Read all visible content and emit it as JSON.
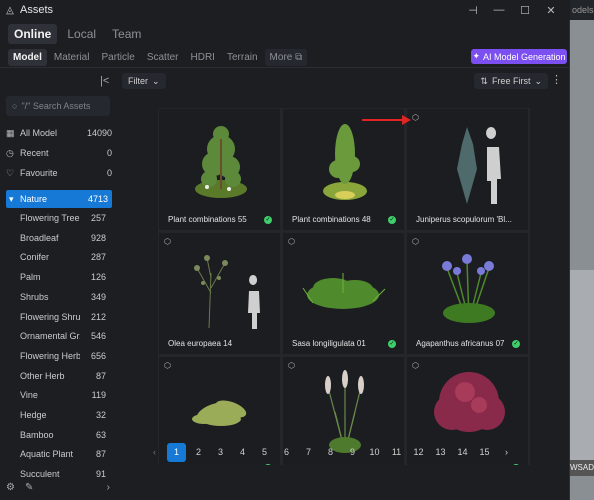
{
  "window": {
    "title": "Assets",
    "controls": [
      "⊣",
      "—",
      "☐",
      "✕"
    ]
  },
  "background_app": {
    "strip_text": "odels 0",
    "wsad_text": "WSAD"
  },
  "source_tabs": [
    {
      "label": "Online",
      "active": true
    },
    {
      "label": "Local",
      "active": false
    },
    {
      "label": "Team",
      "active": false
    }
  ],
  "type_tabs": [
    {
      "label": "Model",
      "active": true
    },
    {
      "label": "Material",
      "active": false
    },
    {
      "label": "Particle",
      "active": false
    },
    {
      "label": "Scatter",
      "active": false
    },
    {
      "label": "HDRI",
      "active": false
    },
    {
      "label": "Terrain",
      "active": false
    },
    {
      "label": "More ⧉",
      "active": false
    }
  ],
  "ai_button": {
    "label": "AI Model Generation"
  },
  "search": {
    "placeholder": "\"/\" Search Assets"
  },
  "top_categories": [
    {
      "label": "All Model",
      "count": "14090",
      "icon": "grid-icon",
      "glyph": "▦"
    },
    {
      "label": "Recent",
      "count": "0",
      "icon": "clock-icon",
      "glyph": "◷"
    },
    {
      "label": "Favourite",
      "count": "0",
      "icon": "heart-icon",
      "glyph": "♡"
    }
  ],
  "nature": {
    "label": "Nature",
    "count": "4713"
  },
  "subcategories": [
    {
      "label": "Flowering Tree",
      "count": "257"
    },
    {
      "label": "Broadleaf",
      "count": "928"
    },
    {
      "label": "Conifer",
      "count": "287"
    },
    {
      "label": "Palm",
      "count": "126"
    },
    {
      "label": "Shrubs",
      "count": "349"
    },
    {
      "label": "Flowering Shrub",
      "count": "212"
    },
    {
      "label": "Ornamental Gr...",
      "count": "546"
    },
    {
      "label": "Flowering Herb",
      "count": "656"
    },
    {
      "label": "Other Herb",
      "count": "87"
    },
    {
      "label": "Vine",
      "count": "119"
    },
    {
      "label": "Hedge",
      "count": "32"
    },
    {
      "label": "Bamboo",
      "count": "63"
    },
    {
      "label": "Aquatic Plant",
      "count": "87"
    },
    {
      "label": "Succulent",
      "count": "91"
    }
  ],
  "toolbar": {
    "filter_label": "Filter",
    "sort_label": "Free First"
  },
  "cards": [
    {
      "name": "Plant combinations 55",
      "checked": true
    },
    {
      "name": "Plant combinations 48",
      "checked": true
    },
    {
      "name": "Juniperus scopulorum 'Bl...",
      "checked": false
    },
    {
      "name": "Olea europaea 14",
      "checked": false
    },
    {
      "name": "Sasa longiligulata 01",
      "checked": true
    },
    {
      "name": "Agapanthus africanus 07",
      "checked": true
    },
    {
      "name": "",
      "checked": true
    },
    {
      "name": "",
      "checked": false
    },
    {
      "name": "",
      "checked": true
    }
  ],
  "pagination": {
    "pages": [
      "1",
      "2",
      "3",
      "4",
      "5",
      "6",
      "7",
      "8",
      "9",
      "10",
      "11",
      "12",
      "13",
      "14",
      "15"
    ],
    "current": "1",
    "prev": "‹",
    "next": "›"
  },
  "colors": {
    "accent": "#1679d6",
    "ai_purple": "#7b4ff0",
    "check_green": "#3ecf6b",
    "annotation_red": "#e02424"
  }
}
